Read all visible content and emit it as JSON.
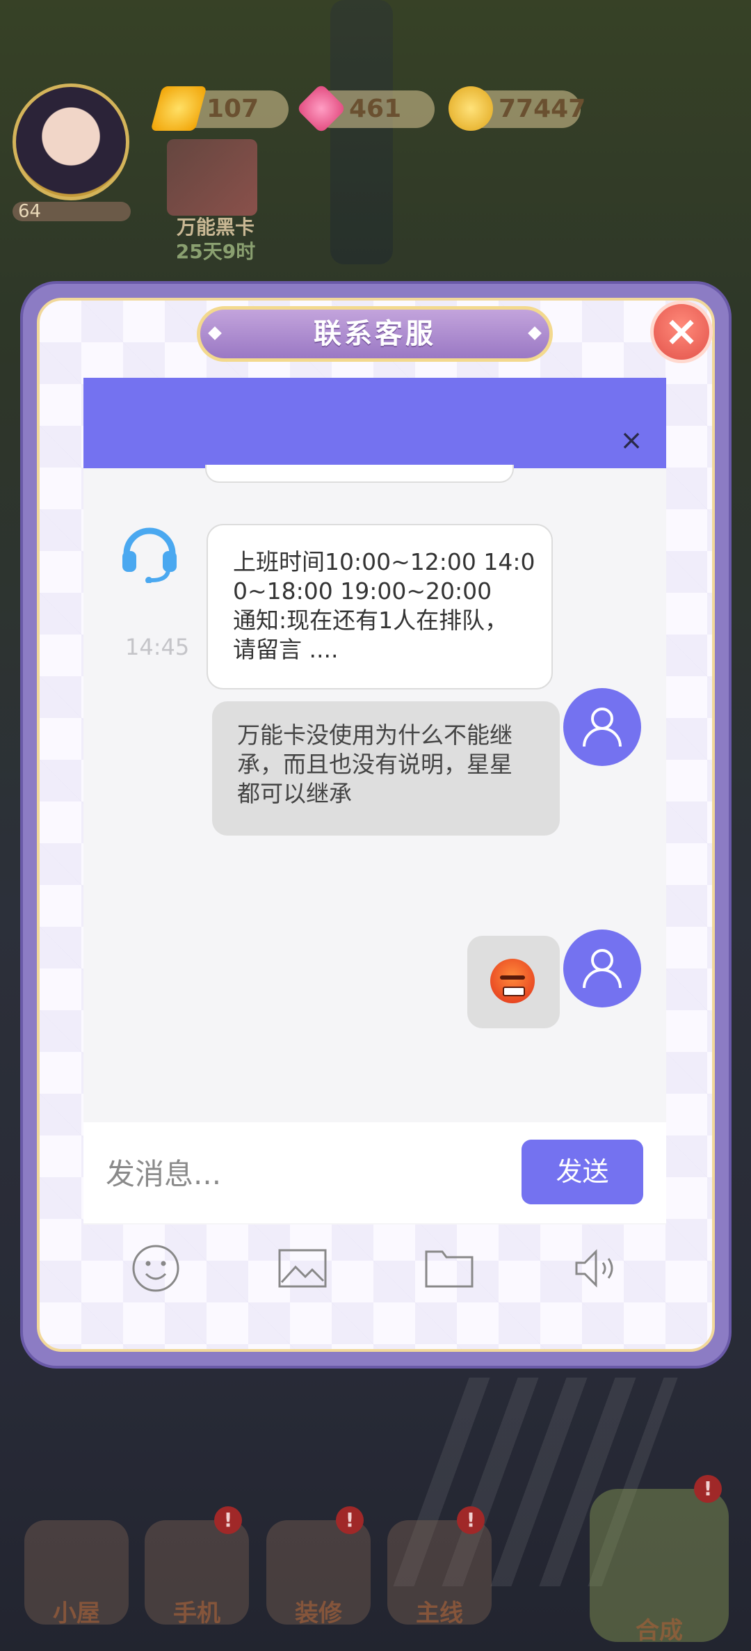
{
  "hud": {
    "level": "64",
    "energy": "107",
    "gems": "461",
    "coins": "77447",
    "card_title": "万能黑卡",
    "card_time": "25天9时"
  },
  "dialog": {
    "title": "联系客服"
  },
  "chat": {
    "messages": [
      {
        "sender": "agent",
        "time": "14:45",
        "lines": [
          "上班时间10:00~12:00 14:0",
          "0~18:00 19:00~20:00",
          "通知:现在还有1人在排队，",
          "请留言 ...."
        ]
      },
      {
        "sender": "user",
        "lines": [
          "万能卡没使用为什么不能继",
          "承，而且也没有说明，星星",
          "都可以继承"
        ]
      },
      {
        "sender": "user",
        "emoji": "angry-face"
      }
    ],
    "input_placeholder": "发消息...",
    "send_label": "发送"
  },
  "toolbar": {
    "icons": [
      "emoji-icon",
      "image-icon",
      "folder-icon",
      "voice-icon"
    ]
  },
  "bottom_nav": {
    "home": "小屋",
    "phone": "手机",
    "decor": "装修",
    "main": "主线",
    "merge": "合成",
    "badge": "!"
  },
  "colors": {
    "accent": "#7472f0",
    "dialog_frame": "#8c7cc4",
    "title_plate": "#b08fd2"
  }
}
